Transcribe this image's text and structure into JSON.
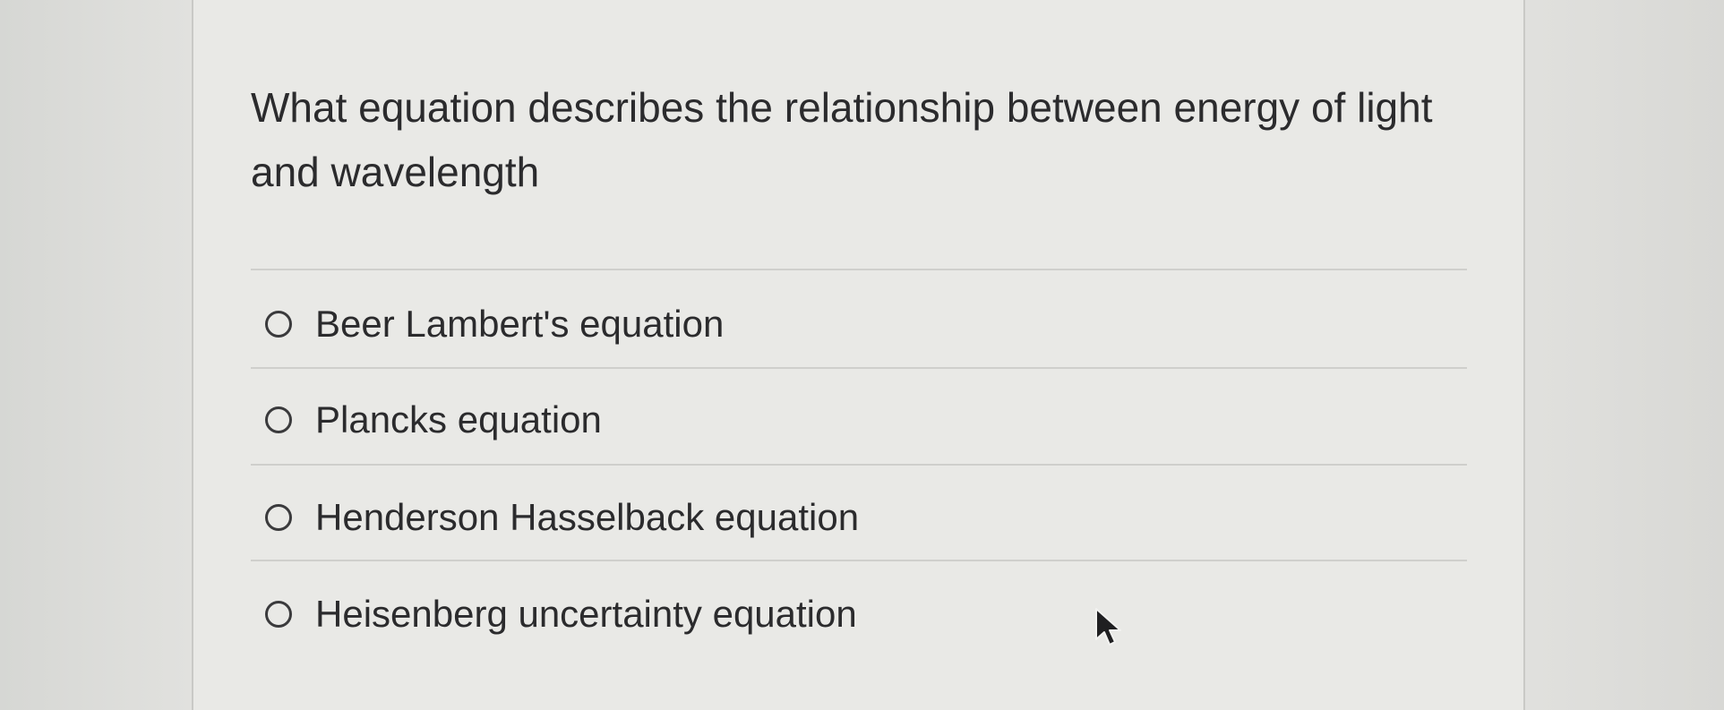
{
  "question": {
    "text": "What equation describes the relationship between energy of light and wavelength"
  },
  "options": [
    {
      "label": "Beer Lambert's equation",
      "selected": false
    },
    {
      "label": "Plancks equation",
      "selected": false
    },
    {
      "label": "Henderson Hasselback equation",
      "selected": false
    },
    {
      "label": "Heisenberg uncertainty equation",
      "selected": false
    }
  ],
  "icons": {
    "radio": "radio-button-icon",
    "cursor": "mouse-pointer-icon"
  },
  "colors": {
    "text": "#2b2b2d",
    "panel": "#e9e9e6",
    "divider": "#cfcfcc"
  }
}
